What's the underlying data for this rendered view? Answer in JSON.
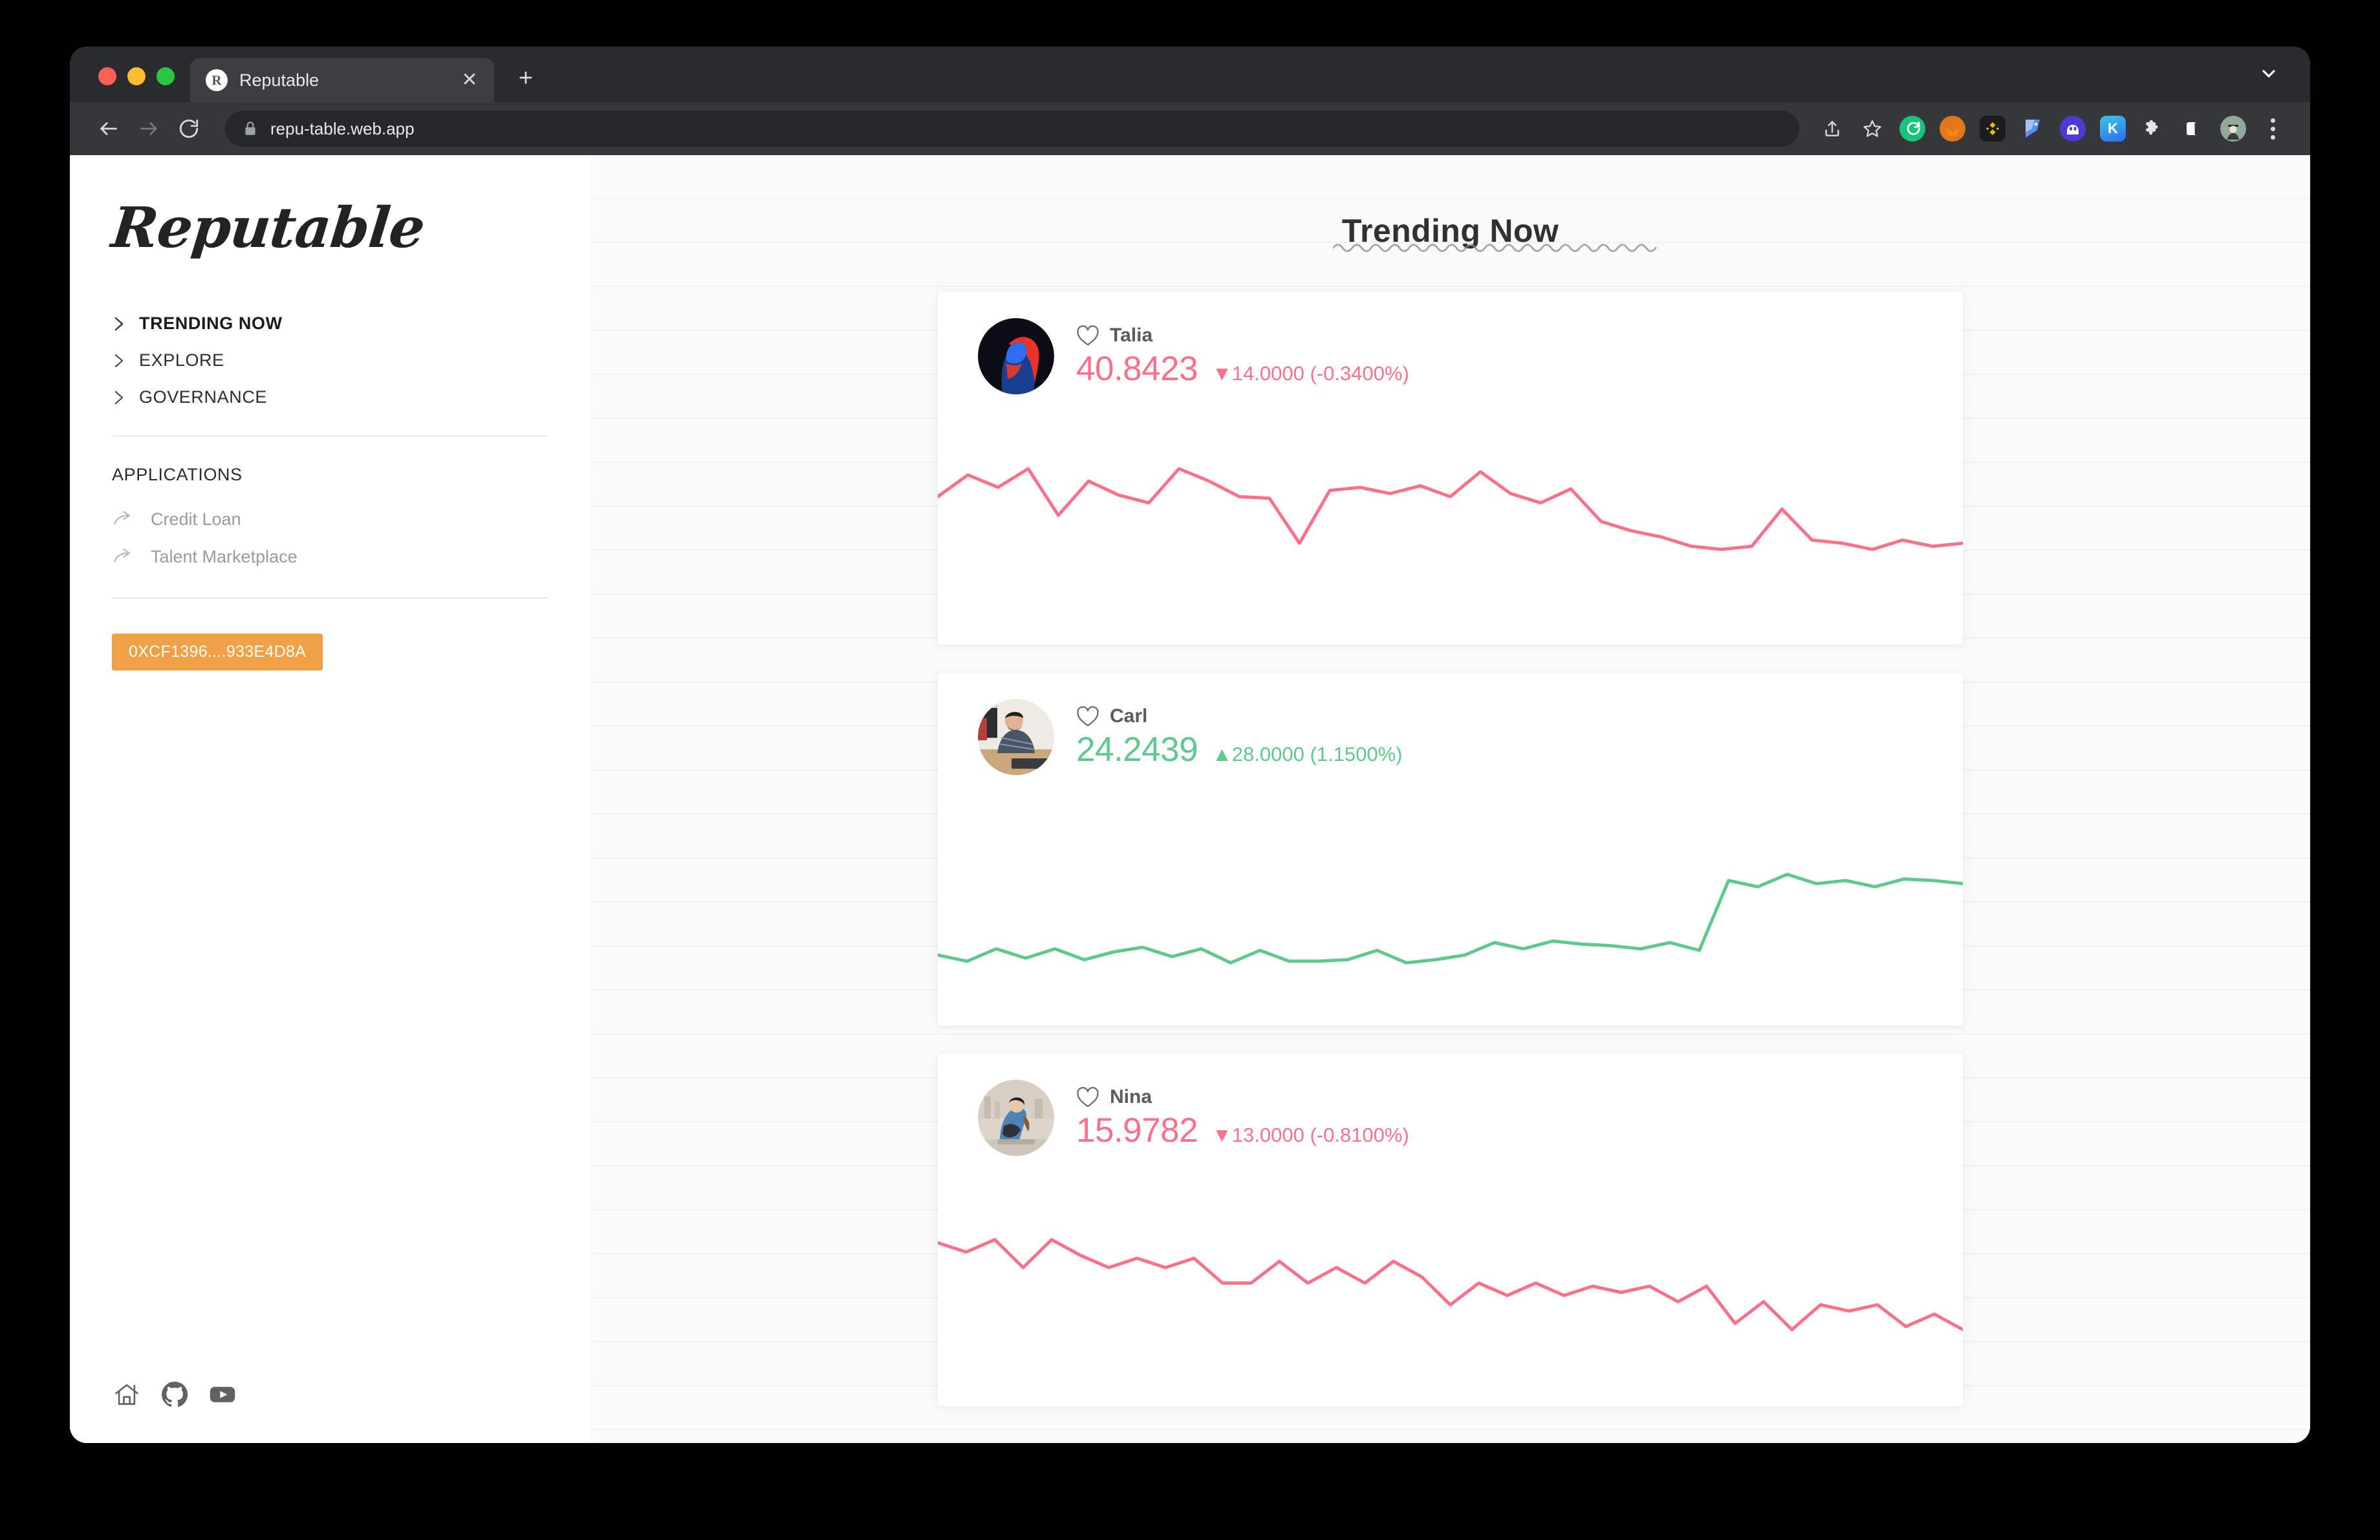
{
  "browser": {
    "tab": {
      "title": "Reputable",
      "favicon_letter": "R",
      "close_icon": "close-icon"
    },
    "new_tab_label": "+",
    "url": "repu-table.web.app",
    "extensions": [
      {
        "name": "rainbow-wallet-extension",
        "label": ""
      },
      {
        "name": "metamask-extension",
        "label": ""
      },
      {
        "name": "binance-wallet-extension",
        "label": ""
      },
      {
        "name": "blue-doc-extension",
        "label": ""
      },
      {
        "name": "phantom-wallet-extension",
        "label": ""
      },
      {
        "name": "keplr-wallet-extension",
        "label": "K"
      },
      {
        "name": "extensions-puzzle-icon",
        "label": ""
      },
      {
        "name": "side-panel-icon",
        "label": ""
      },
      {
        "name": "profile-avatar",
        "label": ""
      }
    ]
  },
  "sidebar": {
    "logo": "Reputable",
    "nav": [
      {
        "label": "TRENDING NOW",
        "active": true
      },
      {
        "label": "EXPLORE",
        "active": false
      },
      {
        "label": "GOVERNANCE",
        "active": false
      }
    ],
    "applications_label": "APPLICATIONS",
    "applications": [
      {
        "label": "Credit Loan"
      },
      {
        "label": "Talent Marketplace"
      }
    ],
    "wallet_address": "0XCF1396....933E4D8A",
    "socials": [
      {
        "name": "home-icon"
      },
      {
        "name": "github-icon"
      },
      {
        "name": "youtube-icon"
      }
    ]
  },
  "main": {
    "title": "Trending Now",
    "cards": [
      {
        "name": "Talia",
        "price": "40.8423",
        "change": "▼14.0000 (-0.3400%)",
        "direction": "down",
        "color": "#fa7189"
      },
      {
        "name": "Carl",
        "price": "24.2439",
        "change": "▲28.0000 (1.1500%)",
        "direction": "up",
        "color": "#5ec98c"
      },
      {
        "name": "Nina",
        "price": "15.9782",
        "change": "▼13.0000 (-0.8100%)",
        "direction": "down",
        "color": "#fa7189"
      }
    ]
  },
  "colors": {
    "accent_orange": "#f0a045",
    "down_pink": "#fa7189",
    "up_green": "#5ec98c",
    "chrome_dark": "#292b2e"
  },
  "chart_data": [
    {
      "type": "line",
      "title": "Talia sparkline",
      "series_name": "Talia",
      "color": "#fa7189",
      "ylim": [
        0,
        100
      ],
      "grid": false,
      "values": [
        72,
        86,
        78,
        90,
        60,
        82,
        73,
        68,
        90,
        82,
        72,
        71,
        42,
        76,
        78,
        74,
        79,
        72,
        88,
        74,
        68,
        77,
        56,
        50,
        46,
        40,
        38,
        40,
        64,
        44,
        42,
        38,
        44,
        40,
        42
      ]
    },
    {
      "type": "line",
      "title": "Carl sparkline",
      "series_name": "Carl",
      "color": "#5ec98c",
      "ylim": [
        0,
        100
      ],
      "grid": false,
      "values": [
        22,
        18,
        26,
        20,
        26,
        19,
        24,
        27,
        21,
        26,
        17,
        25,
        18,
        18,
        19,
        25,
        17,
        19,
        22,
        30,
        26,
        31,
        29,
        28,
        26,
        30,
        25,
        70,
        66,
        74,
        68,
        70,
        66,
        71,
        70,
        68
      ]
    },
    {
      "type": "line",
      "title": "Nina sparkline",
      "series_name": "Nina",
      "color": "#fa7189",
      "ylim": [
        0,
        100
      ],
      "grid": false,
      "values": [
        82,
        76,
        84,
        66,
        84,
        74,
        66,
        72,
        66,
        72,
        56,
        56,
        70,
        56,
        66,
        56,
        70,
        60,
        42,
        56,
        48,
        56,
        48,
        54,
        50,
        54,
        44,
        54,
        30,
        44,
        26,
        42,
        38,
        42,
        28,
        36,
        26
      ]
    }
  ]
}
